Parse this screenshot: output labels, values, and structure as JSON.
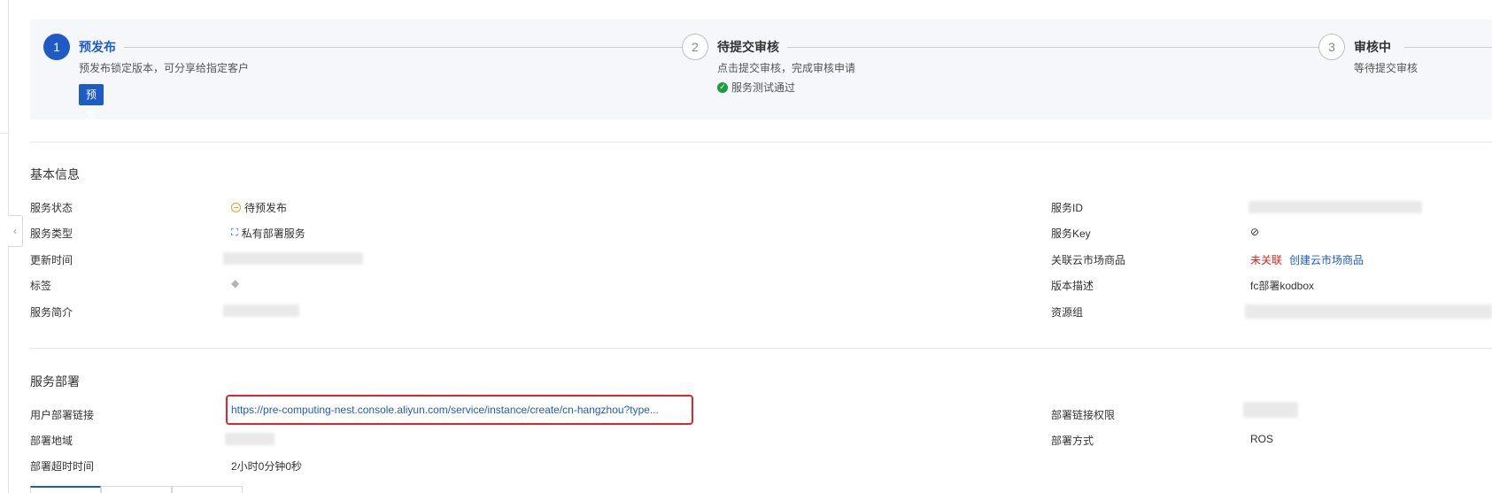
{
  "steps": [
    {
      "number": "1",
      "title": "预发布",
      "desc": "预发布锁定版本，可分享给指定客户",
      "button": "预发布"
    },
    {
      "number": "2",
      "title": "待提交审核",
      "desc": "点击提交审核，完成审核申请",
      "check": "服务测试通过"
    },
    {
      "number": "3",
      "title": "审核中",
      "desc": "等待提交审核"
    }
  ],
  "basic": {
    "title": "基本信息",
    "service_status_label": "服务状态",
    "service_status_value": "待预发布",
    "service_type_label": "服务类型",
    "service_type_value": "私有部署服务",
    "update_time_label": "更新时间",
    "tags_label": "标签",
    "intro_label": "服务简介",
    "service_id_label": "服务ID",
    "service_key_label": "服务Key",
    "market_label": "关联云市场商品",
    "market_status": "未关联",
    "market_link": "创建云市场商品",
    "version_desc_label": "版本描述",
    "version_desc_value": "fc部署kodbox",
    "resource_group_label": "资源组"
  },
  "deploy": {
    "title": "服务部署",
    "user_link_label": "用户部署链接",
    "user_link_value": "https://pre-computing-nest.console.aliyun.com/service/instance/create/cn-hangzhou?type...",
    "region_label": "部署地域",
    "timeout_label": "部署超时时间",
    "timeout_value": "2小时0分钟0秒",
    "permission_label": "部署链接权限",
    "method_label": "部署方式",
    "method_value": "ROS"
  }
}
